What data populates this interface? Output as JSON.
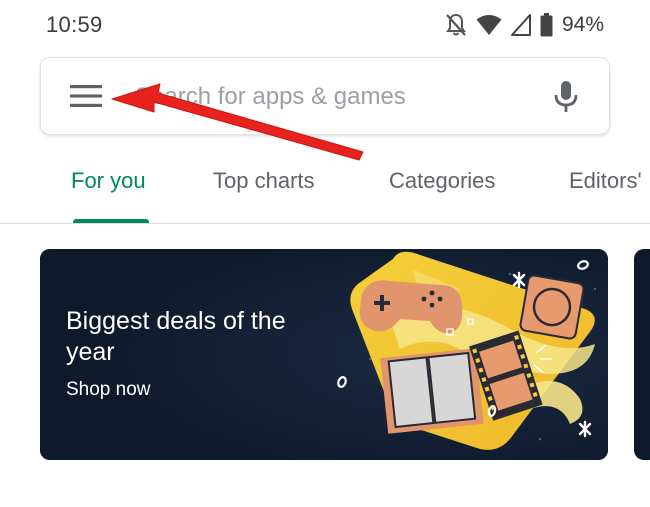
{
  "status_bar": {
    "time": "10:59",
    "battery_percent": "94%",
    "icons": [
      "notifications-off-icon",
      "wifi-icon",
      "cellular-signal-icon",
      "battery-icon"
    ]
  },
  "search": {
    "placeholder": "Search for apps & games",
    "menu_icon": "hamburger-menu-icon",
    "mic_icon": "microphone-icon"
  },
  "tabs": [
    {
      "label": "For you",
      "active": true
    },
    {
      "label": "Top charts",
      "active": false
    },
    {
      "label": "Categories",
      "active": false
    },
    {
      "label": "Editors'",
      "active": false
    }
  ],
  "promo": {
    "title": "Biggest deals of the year",
    "link_label": "Shop now"
  },
  "annotation": {
    "type": "arrow",
    "color": "#e8231d",
    "points_to": "hamburger-menu-icon"
  },
  "colors": {
    "accent": "#01875f",
    "promo_background": "#0e1a2c",
    "text_secondary": "#5f6368"
  }
}
